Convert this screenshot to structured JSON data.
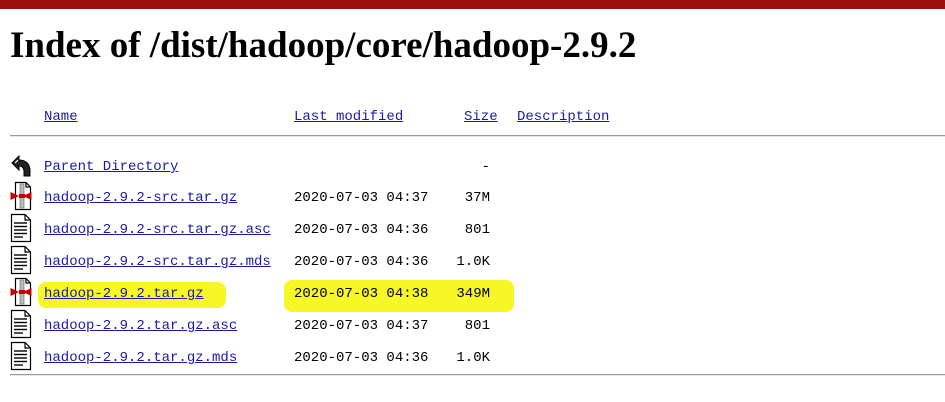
{
  "page": {
    "title": "Index of /dist/hadoop/core/hadoop-2.9.2"
  },
  "columns": {
    "name": "Name",
    "last_modified": "Last modified",
    "size": "Size",
    "description": "Description"
  },
  "parent": {
    "label": "Parent Directory",
    "size": "-",
    "icon": "back-arrow-icon"
  },
  "files": [
    {
      "name": "hadoop-2.9.2-src.tar.gz",
      "modified": "2020-07-03 04:37",
      "size": "37M",
      "icon": "compressed-file-icon"
    },
    {
      "name": "hadoop-2.9.2-src.tar.gz.asc",
      "modified": "2020-07-03 04:36",
      "size": "801",
      "icon": "text-file-icon"
    },
    {
      "name": "hadoop-2.9.2-src.tar.gz.mds",
      "modified": "2020-07-03 04:36",
      "size": "1.0K",
      "icon": "text-file-icon"
    },
    {
      "name": "hadoop-2.9.2.tar.gz",
      "modified": "2020-07-03 04:38",
      "size": "349M",
      "icon": "compressed-file-icon",
      "highlighted": true
    },
    {
      "name": "hadoop-2.9.2.tar.gz.asc",
      "modified": "2020-07-03 04:37",
      "size": "801",
      "icon": "text-file-icon"
    },
    {
      "name": "hadoop-2.9.2.tar.gz.mds",
      "modified": "2020-07-03 04:36",
      "size": "1.0K",
      "icon": "text-file-icon"
    }
  ],
  "colors": {
    "top_bar": "#9b0f0f",
    "link": "#1a1aa6",
    "highlight": "#f7f71a"
  }
}
